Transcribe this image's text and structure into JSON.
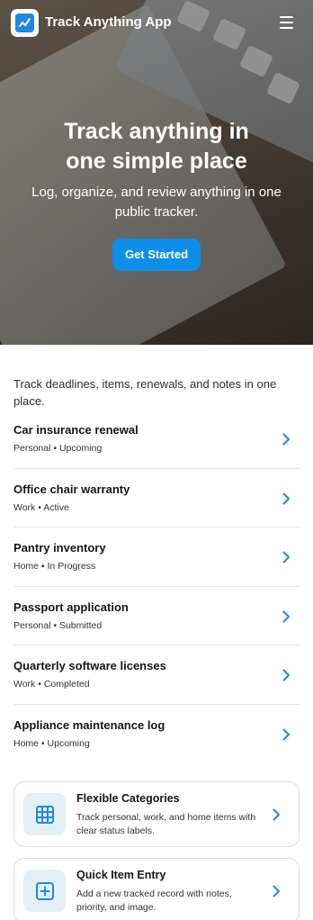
{
  "app": {
    "title": "Track Anything App"
  },
  "icons": {
    "logo": "tracker-logo-icon",
    "menu": "hamburger-menu-icon",
    "chevron": "chevron-right-icon",
    "grid": "grid-icon",
    "add": "plus-square-icon"
  },
  "colors": {
    "accent": "#0d8ee9",
    "accent_dark": "#1e88e5",
    "card_icon_bg": "#e4f0f8"
  },
  "hero": {
    "title": "Track anything in one simple place",
    "subtitle": "Log, organize, and review anything in one public tracker.",
    "cta_label": "Get Started"
  },
  "intro": "Track deadlines, items, renewals, and notes in one place.",
  "items": [
    {
      "title": "Car insurance renewal",
      "meta": "Personal • Upcoming"
    },
    {
      "title": "Office chair warranty",
      "meta": "Work • Active"
    },
    {
      "title": "Pantry inventory",
      "meta": "Home • In Progress"
    },
    {
      "title": "Passport application",
      "meta": "Personal • Submitted"
    },
    {
      "title": "Quarterly software licenses",
      "meta": "Work • Completed"
    },
    {
      "title": "Appliance maintenance log",
      "meta": "Home • Upcoming"
    }
  ],
  "features": [
    {
      "title": "Flexible Categories",
      "description": "Track personal, work, and home items with clear status labels."
    },
    {
      "title": "Quick Item Entry",
      "description": "Add a new tracked record with notes, priority, and image."
    }
  ]
}
